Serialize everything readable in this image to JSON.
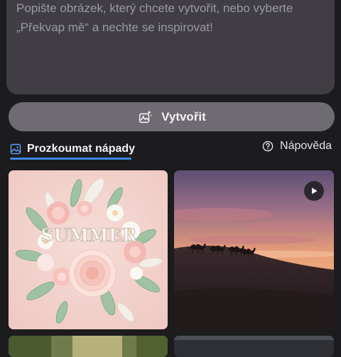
{
  "prompt": {
    "text": "Popište obrázek, který chcete vytvořit, nebo vyberte „Překvap mě“ a nechte se inspirovat!"
  },
  "create_button": {
    "label": "Vytvořit",
    "icon": "sparkle-image-icon"
  },
  "tabs": [
    {
      "label": "Prozkoumat nápady",
      "icon": "image-icon",
      "selected": true
    }
  ],
  "help": {
    "label": "Nápověda",
    "icon": "question-circle-icon"
  },
  "gallery": {
    "items": [
      {
        "type": "image",
        "subject": "paper-flowers-summer",
        "text": "SUMMER"
      },
      {
        "type": "video",
        "subject": "desert-camel-caravan-sunset"
      },
      {
        "type": "image",
        "subject": "forest-partial"
      },
      {
        "type": "image",
        "subject": "dark-partial"
      }
    ]
  },
  "colors": {
    "background": "#1c1b1d",
    "prompt_box": "#403e44",
    "create_button": "#6e6c72",
    "tab_underline": "#3d86e8",
    "tab_icon": "#5b9cf0"
  }
}
